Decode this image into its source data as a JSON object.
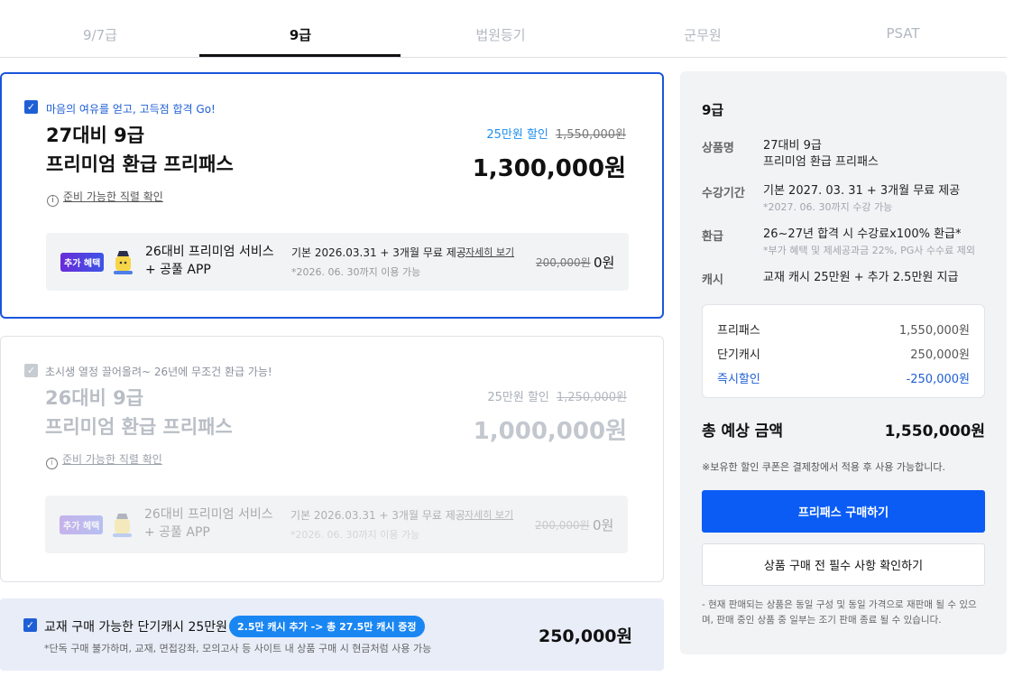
{
  "tabs": [
    {
      "label": "9/7급"
    },
    {
      "label": "9급"
    },
    {
      "label": "법원등기"
    },
    {
      "label": "군무원"
    },
    {
      "label": "PSAT"
    }
  ],
  "selected_tab": "9급",
  "products": [
    {
      "tagline": "마음의 여유를 얻고, 고득점 합격 Go!",
      "title_line1": "27대비 9급",
      "title_line2": "프리미엄 환급 프리패스",
      "discount": "25만원 할인",
      "original_price": "1,550,000원",
      "price": "1,300,000원",
      "info_link": "준비 가능한 직렬 확인",
      "bonus": {
        "badge": "추가 혜택",
        "title_line1": "26대비 프리미엄 서비스",
        "title_line2": "+ 공풀 APP",
        "desc": "기본 2026.03.31 + 3개월 무료 제공",
        "desc_sub": "*2026. 06. 30까지 이용 가능",
        "detail_link": "자세히 보기",
        "original_price": "200,000원",
        "price": "0원"
      }
    },
    {
      "tagline": "초시생 열정 끌어올려~ 26년에 무조건 환급 가능!",
      "title_line1": "26대비 9급",
      "title_line2": "프리미엄 환급 프리패스",
      "discount": "25만원 할인",
      "original_price": "1,250,000원",
      "price": "1,000,000원",
      "info_link": "준비 가능한 직렬 확인",
      "bonus": {
        "badge": "추가 혜택",
        "title_line1": "26대비 프리미엄 서비스",
        "title_line2": "+ 공풀 APP",
        "desc": "기본 2026.03.31 + 3개월 무료 제공",
        "desc_sub": "*2026. 06. 30까지 이용 가능",
        "detail_link": "자세히 보기",
        "original_price": "200,000원",
        "price": "0원"
      }
    }
  ],
  "cash_option": {
    "title": "교재 구매 가능한 단기캐시 25만원",
    "pill": "2.5만 캐시 추가 -> 총 27.5만 캐시 증정",
    "note": "*단독 구매 불가하며, 교재, 면접강좌, 모의고사 등 사이트 내 상품 구매 시 현금처럼 사용 가능",
    "price": "250,000원"
  },
  "summary": {
    "title": "9급",
    "rows": [
      {
        "label": "상품명",
        "value_line1": "27대비 9급",
        "value_line2": "프리미엄 환급 프리패스"
      },
      {
        "label": "수강기간",
        "value_line1": "기본 2027. 03. 31 + 3개월 무료 제공",
        "value_line2": "*2027. 06. 30까지 수강 가능"
      },
      {
        "label": "환급",
        "value_line1": "26~27년 합격 시 수강료x100% 환급*",
        "value_line2": "*부가 혜택 및 제세공과금 22%, PG사 수수료 제외"
      },
      {
        "label": "캐시",
        "value_line1": "교재 캐시 25만원 + 추가 2.5만원 지급",
        "value_line2": ""
      }
    ],
    "price_lines": [
      {
        "label": "프리패스",
        "value": "1,550,000원"
      },
      {
        "label": "단기캐시",
        "value": "250,000원"
      },
      {
        "label": "즉시할인",
        "value": "-250,000원"
      }
    ],
    "total_label": "총 예상 금액",
    "total_value": "1,550,000원",
    "coupon_note": "※보유한 할인 쿠폰은 결제창에서 적용 후 사용 가능합니다.",
    "buy_button": "프리패스 구매하기",
    "check_button": "상품 구매 전 필수 사항 확인하기",
    "footer_note": "- 현재 판매되는 상품은 동일 구성 및 동일 가격으로 재판매 될 수 있으며, 판매 중인 상품 중 일부는 조기 판매 종료 될 수 있습니다."
  },
  "colors": {
    "accent": "#0a5cf5",
    "selected_border": "#1a56db",
    "discount": "#1f8ff0"
  }
}
